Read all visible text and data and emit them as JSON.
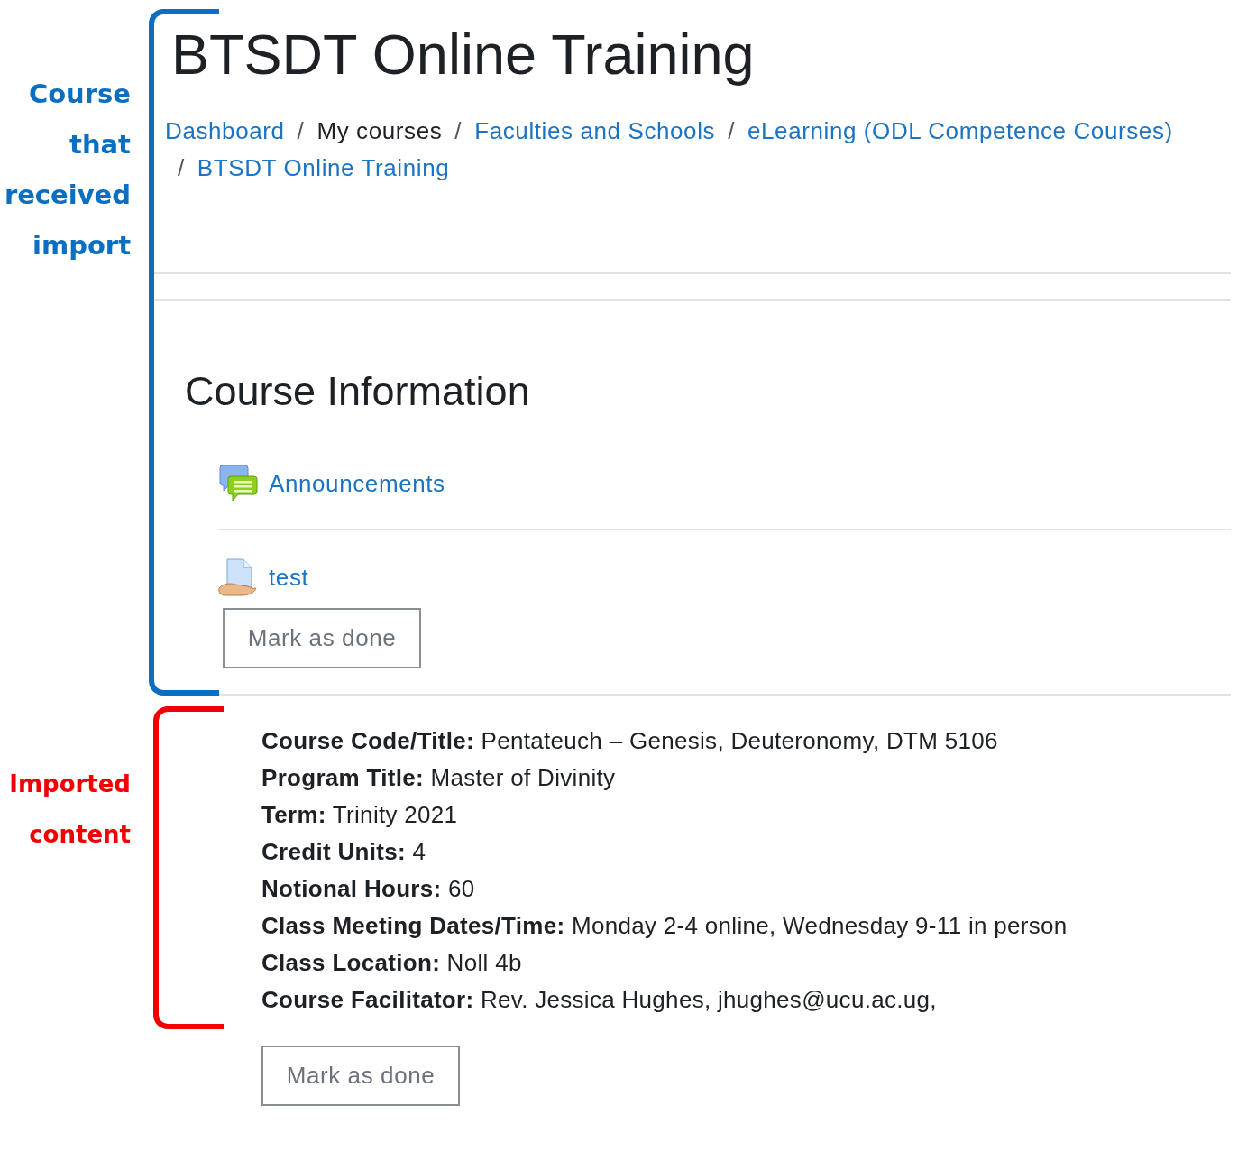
{
  "annotations": [
    {
      "label": "Course that received import",
      "color": "#0a6fc2"
    },
    {
      "label": "Imported content",
      "color": "#f00000"
    }
  ],
  "course": {
    "title": "BTSDT Online Training",
    "breadcrumb": [
      {
        "label": "Dashboard",
        "link": true
      },
      {
        "separator": "/",
        "label": "My courses",
        "link": false
      },
      {
        "separator": "/",
        "label": "Faculties and Schools",
        "link": true
      },
      {
        "separator": "/",
        "label": "eLearning (ODL Competence Courses)",
        "link": true
      },
      {
        "separator": "/",
        "label": "BTSDT Online Training",
        "link": true
      }
    ]
  },
  "section": {
    "title": "Course Information",
    "activities": [
      {
        "name": "Announcements",
        "kind": "forum"
      },
      {
        "name": "test",
        "kind": "resource",
        "button": "Mark as done"
      }
    ]
  },
  "imported": {
    "lines": [
      "**Course Code/Title:** Pentateuch – Genesis, Deuteronomy, DTM 5106",
      "**Program Title:** Master of Divinity",
      "**Term:**  Trinity 2021",
      "**Credit Units:**  4",
      "**Notional Hours:**  60",
      "**Class Meeting Dates/Time:**  Monday 2-4 online, Wednesday 9-11 in person",
      "**Class Location:** Noll 4b",
      "**Course Facilitator:** Rev. Jessica Hughes, jhughes@ucu.ac.ug,"
    ],
    "button": "Mark as done"
  }
}
